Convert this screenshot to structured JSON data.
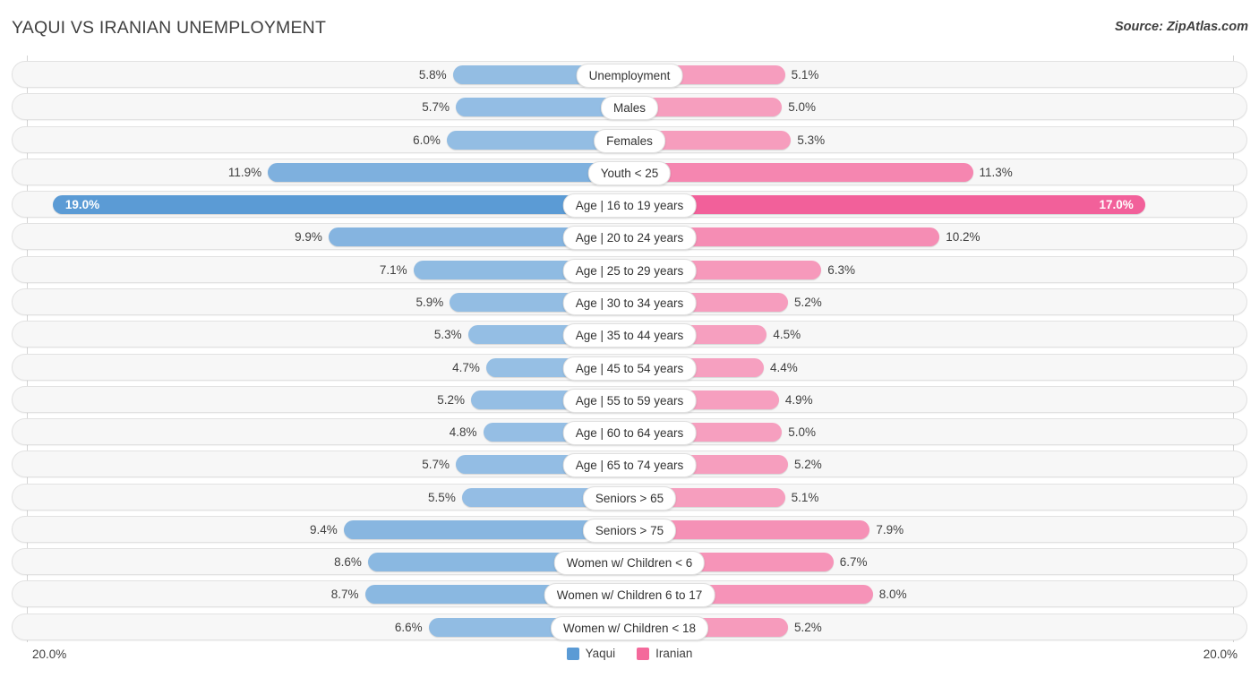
{
  "header": {
    "title": "YAQUI VS IRANIAN UNEMPLOYMENT",
    "source": "Source: ZipAtlas.com"
  },
  "axis": {
    "left_label": "20.0%",
    "right_label": "20.0%",
    "max": 20.0
  },
  "legend": {
    "items": [
      {
        "label": "Yaqui",
        "color": "#5B9BD5"
      },
      {
        "label": "Iranian",
        "color": "#F4699B"
      }
    ]
  },
  "colors": {
    "left_base": "#9DC3E6",
    "left_highlight": "#5B9BD5",
    "right_base": "#F7A8C4",
    "right_highlight": "#F2609A",
    "row_background": "#F7F7F7",
    "row_border": "#E2E2E2",
    "gridline": "#D4D4D4"
  },
  "chart_data": {
    "type": "bar",
    "title": "YAQUI VS IRANIAN UNEMPLOYMENT",
    "subtitle": "",
    "xlabel": "",
    "ylabel": "",
    "orientation": "horizontal-diverging",
    "xlim": [
      20.0,
      20.0
    ],
    "grid": false,
    "legend_position": "bottom-center",
    "categories": [
      "Unemployment",
      "Males",
      "Females",
      "Youth < 25",
      "Age | 16 to 19 years",
      "Age | 20 to 24 years",
      "Age | 25 to 29 years",
      "Age | 30 to 34 years",
      "Age | 35 to 44 years",
      "Age | 45 to 54 years",
      "Age | 55 to 59 years",
      "Age | 60 to 64 years",
      "Age | 65 to 74 years",
      "Seniors > 65",
      "Seniors > 75",
      "Women w/ Children < 6",
      "Women w/ Children 6 to 17",
      "Women w/ Children < 18"
    ],
    "series": [
      {
        "name": "Yaqui",
        "side": "left",
        "color": "#9DC3E6",
        "values": [
          5.8,
          5.7,
          6.0,
          11.9,
          19.0,
          9.9,
          7.1,
          5.9,
          5.3,
          4.7,
          5.2,
          4.8,
          5.7,
          5.5,
          9.4,
          8.6,
          8.7,
          6.6
        ],
        "labels": [
          "5.8%",
          "5.7%",
          "6.0%",
          "11.9%",
          "19.0%",
          "9.9%",
          "7.1%",
          "5.9%",
          "5.3%",
          "4.7%",
          "5.2%",
          "4.8%",
          "5.7%",
          "5.5%",
          "9.4%",
          "8.6%",
          "8.7%",
          "6.6%"
        ]
      },
      {
        "name": "Iranian",
        "side": "right",
        "color": "#F7A8C4",
        "values": [
          5.1,
          5.0,
          5.3,
          11.3,
          17.0,
          10.2,
          6.3,
          5.2,
          4.5,
          4.4,
          4.9,
          5.0,
          5.2,
          5.1,
          7.9,
          6.7,
          8.0,
          5.2
        ],
        "labels": [
          "5.1%",
          "5.0%",
          "5.3%",
          "11.3%",
          "17.0%",
          "10.2%",
          "6.3%",
          "5.2%",
          "4.5%",
          "4.4%",
          "4.9%",
          "5.0%",
          "5.2%",
          "5.1%",
          "7.9%",
          "6.7%",
          "8.0%",
          "5.2%"
        ]
      }
    ],
    "highlighted_row_index": 4
  },
  "rows": [
    {
      "category": "Unemployment",
      "left": 5.8,
      "left_label": "5.8%",
      "right": 5.1,
      "right_label": "5.1%",
      "highlight": false
    },
    {
      "category": "Males",
      "left": 5.7,
      "left_label": "5.7%",
      "right": 5.0,
      "right_label": "5.0%",
      "highlight": false
    },
    {
      "category": "Females",
      "left": 6.0,
      "left_label": "6.0%",
      "right": 5.3,
      "right_label": "5.3%",
      "highlight": false
    },
    {
      "category": "Youth < 25",
      "left": 11.9,
      "left_label": "11.9%",
      "right": 11.3,
      "right_label": "11.3%",
      "highlight": false
    },
    {
      "category": "Age | 16 to 19 years",
      "left": 19.0,
      "left_label": "19.0%",
      "right": 17.0,
      "right_label": "17.0%",
      "highlight": true
    },
    {
      "category": "Age | 20 to 24 years",
      "left": 9.9,
      "left_label": "9.9%",
      "right": 10.2,
      "right_label": "10.2%",
      "highlight": false
    },
    {
      "category": "Age | 25 to 29 years",
      "left": 7.1,
      "left_label": "7.1%",
      "right": 6.3,
      "right_label": "6.3%",
      "highlight": false
    },
    {
      "category": "Age | 30 to 34 years",
      "left": 5.9,
      "left_label": "5.9%",
      "right": 5.2,
      "right_label": "5.2%",
      "highlight": false
    },
    {
      "category": "Age | 35 to 44 years",
      "left": 5.3,
      "left_label": "5.3%",
      "right": 4.5,
      "right_label": "4.5%",
      "highlight": false
    },
    {
      "category": "Age | 45 to 54 years",
      "left": 4.7,
      "left_label": "4.7%",
      "right": 4.4,
      "right_label": "4.4%",
      "highlight": false
    },
    {
      "category": "Age | 55 to 59 years",
      "left": 5.2,
      "left_label": "5.2%",
      "right": 4.9,
      "right_label": "4.9%",
      "highlight": false
    },
    {
      "category": "Age | 60 to 64 years",
      "left": 4.8,
      "left_label": "4.8%",
      "right": 5.0,
      "right_label": "5.0%",
      "highlight": false
    },
    {
      "category": "Age | 65 to 74 years",
      "left": 5.7,
      "left_label": "5.7%",
      "right": 5.2,
      "right_label": "5.2%",
      "highlight": false
    },
    {
      "category": "Seniors > 65",
      "left": 5.5,
      "left_label": "5.5%",
      "right": 5.1,
      "right_label": "5.1%",
      "highlight": false
    },
    {
      "category": "Seniors > 75",
      "left": 9.4,
      "left_label": "9.4%",
      "right": 7.9,
      "right_label": "7.9%",
      "highlight": false
    },
    {
      "category": "Women w/ Children < 6",
      "left": 8.6,
      "left_label": "8.6%",
      "right": 6.7,
      "right_label": "6.7%",
      "highlight": false
    },
    {
      "category": "Women w/ Children 6 to 17",
      "left": 8.7,
      "left_label": "8.7%",
      "right": 8.0,
      "right_label": "8.0%",
      "highlight": false
    },
    {
      "category": "Women w/ Children < 18",
      "left": 6.6,
      "left_label": "6.6%",
      "right": 5.2,
      "right_label": "5.2%",
      "highlight": false
    }
  ]
}
